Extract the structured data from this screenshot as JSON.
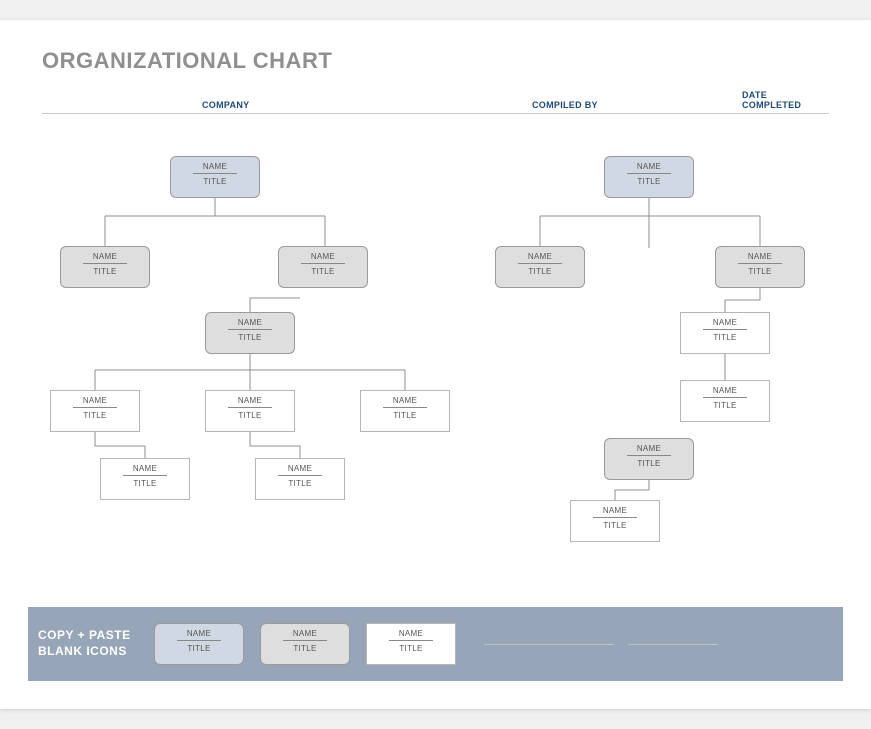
{
  "title": "ORGANIZATIONAL CHART",
  "headers": {
    "company": "COMPANY",
    "compiled_by": "COMPILED BY",
    "date_completed": "DATE COMPLETED"
  },
  "placeholder": {
    "name": "NAME",
    "title": "TITLE"
  },
  "footer": {
    "label": "COPY + PASTE\nBLANK ICONS"
  },
  "chart_data": {
    "type": "org-chart-template",
    "trees": [
      {
        "root": {
          "name": "NAME",
          "title": "TITLE",
          "style": "blue"
        },
        "children": [
          {
            "name": "NAME",
            "title": "TITLE",
            "style": "gray"
          },
          {
            "name": "NAME",
            "title": "TITLE",
            "style": "gray",
            "children": [
              {
                "name": "NAME",
                "title": "TITLE",
                "style": "gray",
                "children": [
                  {
                    "name": "NAME",
                    "title": "TITLE",
                    "style": "white",
                    "children": [
                      {
                        "name": "NAME",
                        "title": "TITLE",
                        "style": "white"
                      }
                    ]
                  },
                  {
                    "name": "NAME",
                    "title": "TITLE",
                    "style": "white",
                    "children": [
                      {
                        "name": "NAME",
                        "title": "TITLE",
                        "style": "white"
                      }
                    ]
                  },
                  {
                    "name": "NAME",
                    "title": "TITLE",
                    "style": "white"
                  }
                ]
              }
            ]
          }
        ]
      },
      {
        "root": {
          "name": "NAME",
          "title": "TITLE",
          "style": "blue"
        },
        "children": [
          {
            "name": "NAME",
            "title": "TITLE",
            "style": "gray"
          },
          {
            "name": "NAME",
            "title": "TITLE",
            "style": "gray",
            "children": [
              {
                "name": "NAME",
                "title": "TITLE",
                "style": "white",
                "children": [
                  {
                    "name": "NAME",
                    "title": "TITLE",
                    "style": "white"
                  }
                ]
              },
              {
                "via": "center-line",
                "name": "NAME",
                "title": "TITLE",
                "style": "gray",
                "children": [
                  {
                    "name": "NAME",
                    "title": "TITLE",
                    "style": "white"
                  }
                ]
              }
            ]
          }
        ]
      }
    ],
    "palette_samples": [
      {
        "style": "blue"
      },
      {
        "style": "gray"
      },
      {
        "style": "white"
      }
    ]
  }
}
